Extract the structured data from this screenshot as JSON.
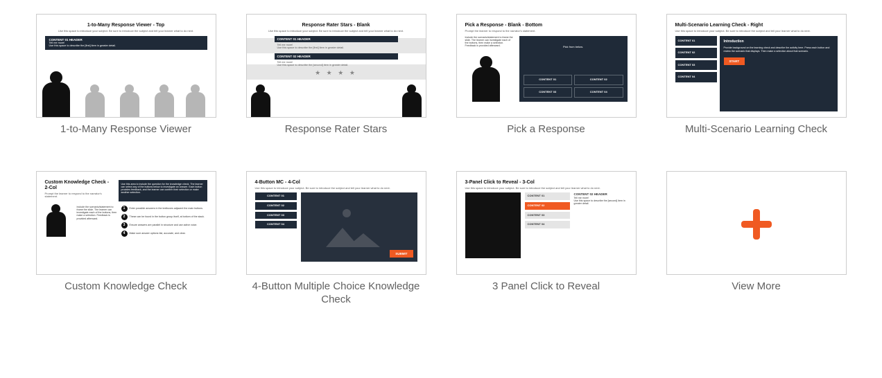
{
  "common": {
    "subtitle": "Use this space to introduce your subject. Be sure to introduce the subject and tell your learner what to do next.",
    "more": "Tell me more!",
    "desc_first": "Use this space to describe the [first] item in greater detail.",
    "desc_second": "Use this space to describe the [second] item in greater detail.",
    "content01h": "CONTENT 01 HEADER",
    "content02h": "CONTENT 02 HEADER",
    "content": [
      "CONTENT 01",
      "CONTENT 02",
      "CONTENT 03",
      "CONTENT 04"
    ]
  },
  "cards": {
    "c1": {
      "caption": "1-to-Many Response Viewer",
      "title": "1-to-Many Response Viewer - Top"
    },
    "c2": {
      "caption": "Response Rater Stars",
      "title": "Response Rater Stars - Blank",
      "stars": "★ ★ ★ ★"
    },
    "c3": {
      "caption": "Pick a Response",
      "title": "Pick a Response - Blank - Bottom",
      "prompt": "Prompt the learner to respond to the narrator's statement.",
      "include": "Include the scenario/statement to frame the slide. The learner can investigate each of the buttons, then make a selection. Feedback is provided afterward.",
      "pick": "Pick from below."
    },
    "c4": {
      "caption": "Multi-Scenario Learning Check",
      "title": "Multi-Scenario Learning Check - Right",
      "intro_h": "Introduction",
      "intro_b": "Provide background on the learning check and describe the activity here. Press each button and review the scenario that displays. Then make a selection about that scenario.",
      "start": "START"
    },
    "c5": {
      "caption": "Custom Knowledge Check",
      "title": "Custom Knowledge Check - 2-Col",
      "prompt": "Prompt the learner to respond to the narrator's statement.",
      "box": "Use this area to include the question for the knowledge check. The learner can select any of the buttons below to investigate an answer. Each button provides feedback, and the learner can confirm their selection or make another selection.",
      "left": "Include the scenario/statement to frame the slide. The learner can investigate each of the buttons, then make a selection. Feedback is provided afterward.",
      "b1": "Enter possible answers in the textboxes adjacent the main buttons.",
      "b2": "These can be found in the button group itself, at bottom of the stack.",
      "b3": "Ensure answers are parallel in structure and use active voice.",
      "b4": "Make sure answer options fair, accurate, and clear."
    },
    "c6": {
      "caption": "4-Button Multiple Choice Knowledge Check",
      "title": "4-Button MC - 4-Col",
      "submit": "SUBMIT"
    },
    "c7": {
      "caption": "3 Panel Click to Reveal",
      "title": "3-Panel Click to Reveal - 3-Col"
    },
    "c8": {
      "caption": "View More"
    }
  }
}
